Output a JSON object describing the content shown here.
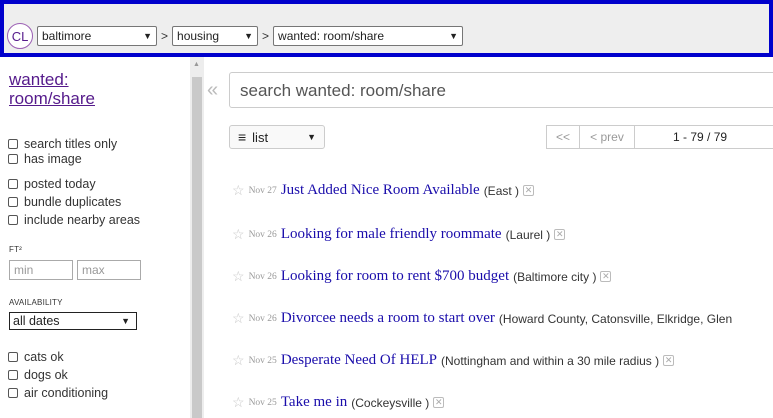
{
  "topbar": {
    "logo": "CL",
    "area": "baltimore",
    "section": "housing",
    "category": "wanted: room/share",
    "separator": ">"
  },
  "sidebar": {
    "category_title": "wanted: room/share",
    "options": [
      "search titles only",
      "has image",
      "posted today",
      "bundle duplicates",
      "include nearby areas"
    ],
    "sqft_label": "FT²",
    "sqft_min_placeholder": "min",
    "sqft_max_placeholder": "max",
    "availability_label": "AVAILABILITY",
    "availability_value": "all dates",
    "amenities": [
      "cats ok",
      "dogs ok",
      "air conditioning"
    ]
  },
  "search": {
    "collapse_icon": "«",
    "placeholder": "search wanted: room/share"
  },
  "toolbar": {
    "view_label": "list",
    "first": "<<",
    "prev": "< prev",
    "range": "1 - 79 / 79"
  },
  "listings": [
    {
      "date": "Nov 27",
      "title": "Just Added Nice Room Available",
      "location": "(East )"
    },
    {
      "date": "Nov 26",
      "title": "Looking for male friendly roommate",
      "location": "(Laurel )"
    },
    {
      "date": "Nov 26",
      "title": "Looking for room to rent $700 budget",
      "location": "(Baltimore city )"
    },
    {
      "date": "Nov 26",
      "title": "Divorcee needs a room to start over",
      "location": "(Howard County, Catonsville, Elkridge, Glen"
    },
    {
      "date": "Nov 25",
      "title": "Desperate Need Of HELP",
      "location": "(Nottingham and within a 30 mile radius )"
    },
    {
      "date": "Nov 25",
      "title": "Take me in",
      "location": "(Cockeysville )"
    }
  ],
  "colors": {
    "topbar_border": "#0000cc",
    "link": "#1a0dab",
    "visited": "#551a8b"
  }
}
